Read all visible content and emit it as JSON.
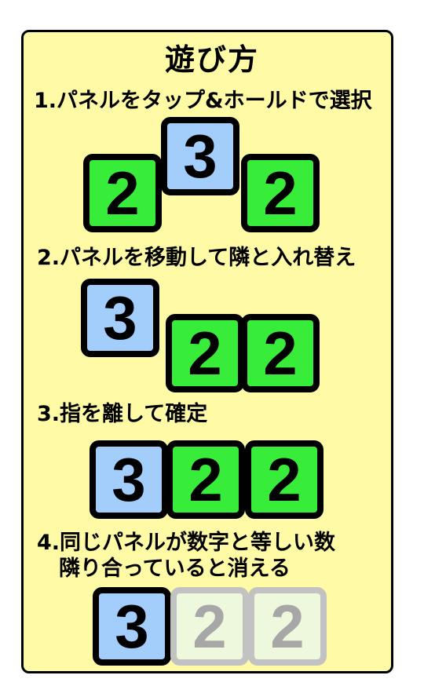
{
  "title": "遊び方",
  "colors": {
    "card_bg": "#fffaa6",
    "blue_tile": "#a3cdfa",
    "green_tile": "#38ec3a",
    "faded_tile": "#eef8dc"
  },
  "steps": [
    {
      "text": "1.パネルをタップ&ホールドで選択",
      "tiles": [
        {
          "value": "2",
          "color": "green"
        },
        {
          "value": "3",
          "color": "blue"
        },
        {
          "value": "2",
          "color": "green"
        }
      ]
    },
    {
      "text": "2.パネルを移動して隣と入れ替え",
      "tiles": [
        {
          "value": "3",
          "color": "blue"
        },
        {
          "value": "2",
          "color": "green"
        },
        {
          "value": "2",
          "color": "green"
        }
      ]
    },
    {
      "text": "3.指を離して確定",
      "tiles": [
        {
          "value": "3",
          "color": "blue"
        },
        {
          "value": "2",
          "color": "green"
        },
        {
          "value": "2",
          "color": "green"
        }
      ]
    },
    {
      "text_line1": "4.同じパネルが数字と等しい数",
      "text_line2": "隣り合っていると消える",
      "tiles": [
        {
          "value": "3",
          "color": "blue"
        },
        {
          "value": "2",
          "color": "faded"
        },
        {
          "value": "2",
          "color": "faded"
        }
      ]
    }
  ]
}
